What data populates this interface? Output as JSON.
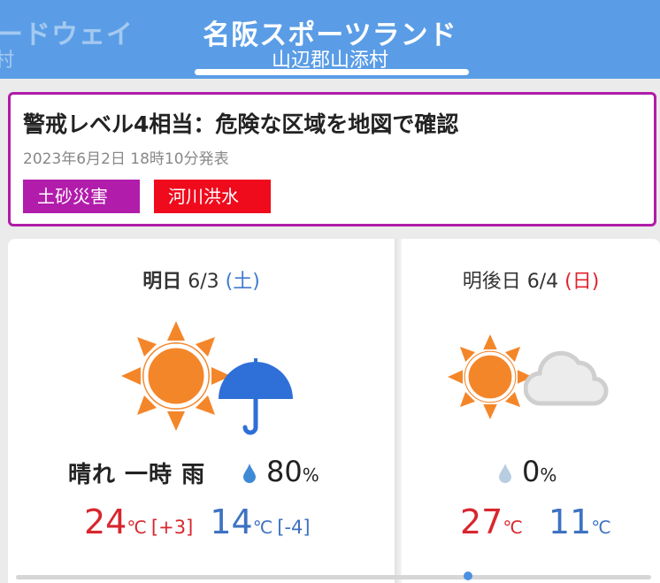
{
  "header": {
    "ghost_title": "ードウェイ",
    "ghost_subtitle": "村",
    "title": "名阪スポーツランド",
    "subtitle": "山辺郡山添村"
  },
  "alert": {
    "title": "警戒レベル4相当：危険な区域を地図で確認",
    "issued": "2023年6月2日 18時10分発表",
    "badges": [
      {
        "label": "土砂災害",
        "color": "#b21cab"
      },
      {
        "label": "河川洪水",
        "color": "#ef0a1c"
      }
    ]
  },
  "forecast": [
    {
      "day_name": "明日",
      "date": "6/3",
      "weekday": "(土)",
      "weather": "晴れ 一時 雨",
      "icons": [
        "sun-icon",
        "umbrella-icon"
      ],
      "precip": "80",
      "precip_unit": "%",
      "high": "24",
      "high_unit": "℃",
      "high_diff": "[+3]",
      "low": "14",
      "low_unit": "℃",
      "low_diff": "[-4]"
    },
    {
      "day_name": "明後日",
      "date": "6/4",
      "weekday": "(日)",
      "weather": "",
      "icons": [
        "sun-icon",
        "cloud-icon"
      ],
      "precip": "0",
      "precip_unit": "%",
      "high": "27",
      "high_unit": "℃",
      "low": "11",
      "low_unit": "℃"
    }
  ],
  "colors": {
    "header_bg": "#5a9de6",
    "alert_border": "#b01ca8",
    "high_temp": "#d8262e",
    "low_temp": "#3e72c2",
    "sun": "#f4862a",
    "umbrella": "#2f6fd8"
  }
}
